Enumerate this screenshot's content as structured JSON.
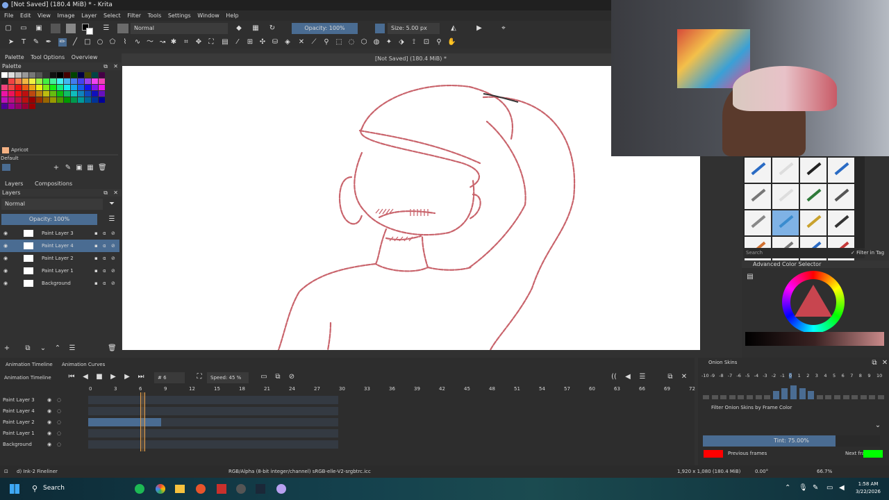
{
  "window": {
    "title": "[Not Saved]  (180.4 MiB) * - Krita"
  },
  "menu": [
    "File",
    "Edit",
    "View",
    "Image",
    "Layer",
    "Select",
    "Filter",
    "Tools",
    "Settings",
    "Window",
    "Help"
  ],
  "toolbar": {
    "blend_mode": "Normal",
    "opacity": "Opacity: 100%",
    "size": "Size: 5.00 px"
  },
  "dockers": {
    "tabs": [
      "Palette",
      "Tool Options",
      "Overview"
    ],
    "palette_title": "Palette",
    "color_name": "Apricot",
    "palette_set": "Default"
  },
  "layers_panel": {
    "tabs": [
      "Layers",
      "Compositions"
    ],
    "title": "Layers",
    "blend": "Normal",
    "opacity": "Opacity: 100%",
    "layers": [
      {
        "name": "Paint Layer 3",
        "selected": false
      },
      {
        "name": "Paint Layer 4",
        "selected": true
      },
      {
        "name": "Paint Layer 2",
        "selected": false
      },
      {
        "name": "Paint Layer 1",
        "selected": false
      },
      {
        "name": "Background",
        "selected": false
      }
    ]
  },
  "canvas": {
    "title": "[Not Saved]  (180.4 MiB) *"
  },
  "brushes": {
    "search": "Search",
    "filter_tag": "Filter in Tag"
  },
  "color_selector": {
    "title": "Advanced Color Selector"
  },
  "timeline": {
    "tabs": [
      "Animation Timeline",
      "Animation Curves"
    ],
    "title": "Animation Timeline",
    "frame": "6",
    "speed": "Speed: 45 %",
    "ruler": [
      "0",
      "3",
      "6",
      "9",
      "12",
      "15",
      "18",
      "21",
      "24",
      "27",
      "30",
      "33",
      "36",
      "39",
      "42",
      "45",
      "48",
      "51",
      "54",
      "57",
      "60",
      "63",
      "66",
      "69",
      "72"
    ],
    "layers": [
      "Paint Layer 3",
      "Paint Layer 4",
      "Paint Layer 2",
      "Paint Layer 1",
      "Background"
    ]
  },
  "onion": {
    "title": "Onion Skins",
    "numbers": [
      "-10",
      "-9",
      "-8",
      "-7",
      "-6",
      "-5",
      "-4",
      "-3",
      "-2",
      "-1",
      "0",
      "1",
      "2",
      "3",
      "4",
      "5",
      "6",
      "7",
      "8",
      "9",
      "10"
    ],
    "filter": "Filter Onion Skins by Frame Color",
    "tint": "Tint: 75.00%",
    "previous": "Previous frames",
    "next": "Next frames",
    "prev_color": "#ff0000",
    "next_color": "#00ff00"
  },
  "status": {
    "brush": "d) Ink-2 Fineliner",
    "color_space": "RGB/Alpha (8-bit integer/channel)  sRGB-elle-V2-srgbtrc.icc",
    "dims": "1,920 x 1,080 (180.4 MiB)",
    "rotation": "0.00°",
    "zoom": "66.7%"
  },
  "taskbar": {
    "search": "Search",
    "time": "1:58 AM",
    "date": "3/22/2026"
  }
}
